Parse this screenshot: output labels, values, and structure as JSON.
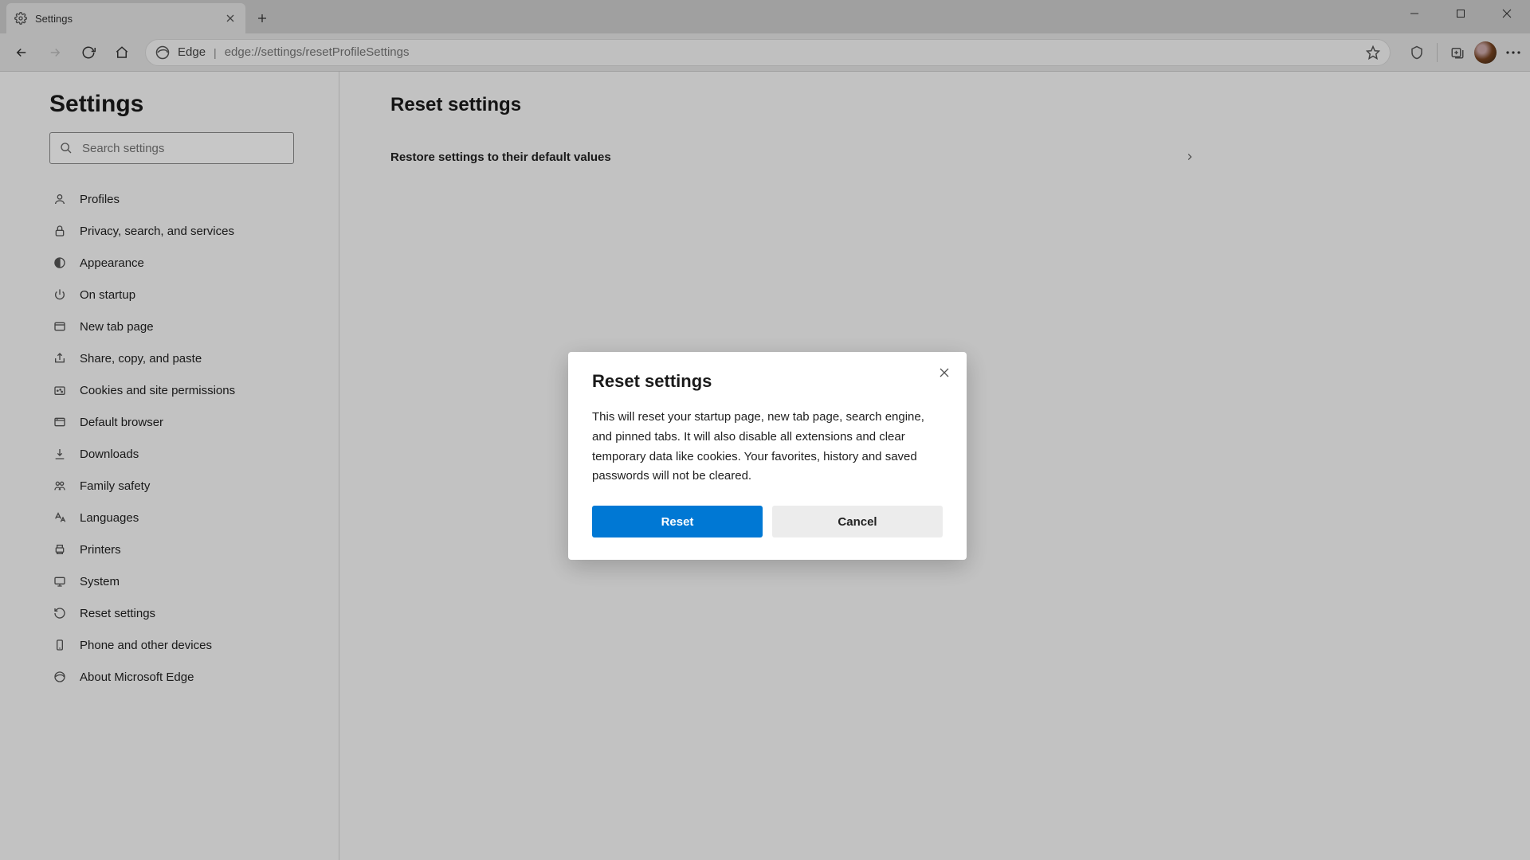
{
  "tab": {
    "title": "Settings"
  },
  "addr": {
    "origin": "Edge",
    "url": "edge://settings/resetProfileSettings"
  },
  "sidebar": {
    "title": "Settings",
    "search_placeholder": "Search settings",
    "items": [
      {
        "label": "Profiles",
        "icon": "profiles-icon"
      },
      {
        "label": "Privacy, search, and services",
        "icon": "lock-icon"
      },
      {
        "label": "Appearance",
        "icon": "appearance-icon"
      },
      {
        "label": "On startup",
        "icon": "power-icon"
      },
      {
        "label": "New tab page",
        "icon": "newtab-icon"
      },
      {
        "label": "Share, copy, and paste",
        "icon": "share-icon"
      },
      {
        "label": "Cookies and site permissions",
        "icon": "cookies-icon"
      },
      {
        "label": "Default browser",
        "icon": "browser-icon"
      },
      {
        "label": "Downloads",
        "icon": "download-icon"
      },
      {
        "label": "Family safety",
        "icon": "family-icon"
      },
      {
        "label": "Languages",
        "icon": "languages-icon"
      },
      {
        "label": "Printers",
        "icon": "printer-icon"
      },
      {
        "label": "System",
        "icon": "system-icon"
      },
      {
        "label": "Reset settings",
        "icon": "reset-icon"
      },
      {
        "label": "Phone and other devices",
        "icon": "phone-icon"
      },
      {
        "label": "About Microsoft Edge",
        "icon": "edge-icon"
      }
    ]
  },
  "main": {
    "heading": "Reset settings",
    "row_label": "Restore settings to their default values"
  },
  "dialog": {
    "title": "Reset settings",
    "body": "This will reset your startup page, new tab page, search engine, and pinned tabs. It will also disable all extensions and clear temporary data like cookies. Your favorites, history and saved passwords will not be cleared.",
    "primary": "Reset",
    "secondary": "Cancel"
  }
}
